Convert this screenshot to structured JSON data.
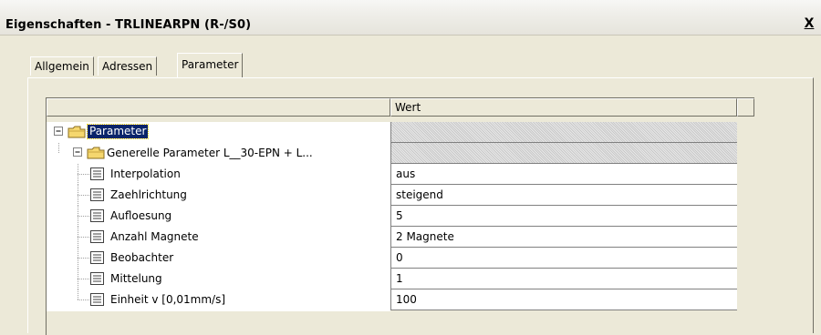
{
  "window": {
    "title": "Eigenschaften - TRLINEARPN (R-/S0)",
    "close_glyph": "X"
  },
  "tabs": [
    {
      "label": "Allgemein",
      "active": false
    },
    {
      "label": "Adressen",
      "active": false
    },
    {
      "label": "Parameter",
      "active": true
    }
  ],
  "grid": {
    "columns": [
      "",
      "Wert"
    ],
    "rows": [
      {
        "label": "Parameter",
        "value": "",
        "icon": "folder-icon",
        "level": 0,
        "selected": true
      },
      {
        "label": "Generelle Parameter L__30-EPN + L...",
        "value": "",
        "icon": "folder-icon",
        "level": 1,
        "selected": false
      },
      {
        "label": "Interpolation",
        "value": "aus",
        "icon": "parameter-icon",
        "level": 2
      },
      {
        "label": "Zaehlrichtung",
        "value": "steigend",
        "icon": "parameter-icon",
        "level": 2
      },
      {
        "label": "Aufloesung",
        "value": "5",
        "icon": "parameter-icon",
        "level": 2
      },
      {
        "label": "Anzahl Magnete",
        "value": "2 Magnete",
        "icon": "parameter-icon",
        "level": 2
      },
      {
        "label": "Beobachter",
        "value": "0",
        "icon": "parameter-icon",
        "level": 2
      },
      {
        "label": "Mittelung",
        "value": "1",
        "icon": "parameter-icon",
        "level": 2
      },
      {
        "label": "Einheit v [0,01mm/s]",
        "value": "100",
        "icon": "parameter-icon",
        "level": 2
      }
    ]
  },
  "colors": {
    "selection": "#0a246a",
    "dialog_background": "#ece9d8",
    "folder": "#f5d76e"
  }
}
